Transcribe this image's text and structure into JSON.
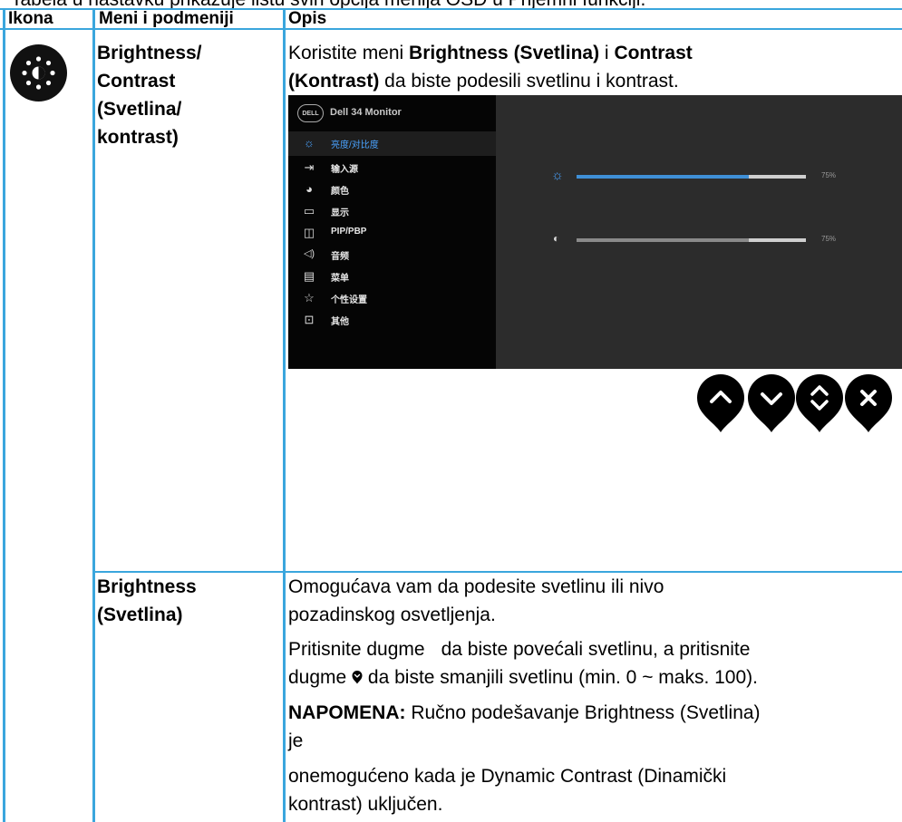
{
  "intro_text": "Tabela u nastavku prikazuje listu svih opcija menija OSD u Prijemni funkciji.",
  "headers": {
    "icon": "Ikona",
    "menu": "Meni i podmeniji",
    "desc": "Opis"
  },
  "rows": [
    {
      "menu_lines": [
        "Brightness/",
        "Contrast",
        "(Svetlina/",
        "kontrast)"
      ],
      "desc_parts": {
        "p1": "Koristite meni ",
        "b1": "Brightness (Svetlina)",
        "p2": " i ",
        "b2": "Contrast",
        "b3": "(Kontrast)",
        "p3": " da biste podesili svetlinu i kontrast."
      }
    },
    {
      "menu_lines": [
        "Brightness",
        "(Svetlina)"
      ],
      "desc_lines": [
        "Omogućava vam da podesite svetlinu ili nivo",
        "pozadinskog osvetljenja.",
        "Pritisnite dugme",
        "da biste povećali svetlinu, a pritisnite",
        "dugme",
        "da biste smanjili svetlinu (min. 0 ~ maks. 100).",
        "NAPOMENA:",
        " Ručno podešavanje Brightness (Svetlina)",
        "je",
        "onemogućeno kada je Dynamic Contrast (Dinamički",
        "kontrast) uključen."
      ]
    }
  ],
  "osd": {
    "logo": "DELL",
    "title": "Dell 34 Monitor",
    "menu_items": [
      {
        "icon": "sun-icon",
        "label": "亮度/对比度",
        "active": true
      },
      {
        "icon": "input-source-icon",
        "label": "输入源"
      },
      {
        "icon": "palette-icon",
        "label": "颜色"
      },
      {
        "icon": "display-icon",
        "label": "显示"
      },
      {
        "icon": "pip-icon",
        "label": "PIP/PBP"
      },
      {
        "icon": "audio-icon",
        "label": "音频"
      },
      {
        "icon": "menu-icon",
        "label": "菜单"
      },
      {
        "icon": "star-icon",
        "label": "个性设置"
      },
      {
        "icon": "other-icon",
        "label": "其他"
      }
    ],
    "sliders": [
      {
        "icon": "brightness-icon",
        "value": 75,
        "value_label": "75%",
        "fill_color": "#3f8fd6"
      },
      {
        "icon": "contrast-icon",
        "value": 75,
        "value_label": "75%",
        "fill_color": "#8a8a8a"
      }
    ],
    "nav_buttons": [
      "up-button",
      "down-button",
      "select-button",
      "exit-button"
    ]
  },
  "colors": {
    "border": "#3aa6dd",
    "osd_bg": "#2c2c2c",
    "osd_menu_bg": "#050505",
    "accent": "#3f8fd6"
  }
}
